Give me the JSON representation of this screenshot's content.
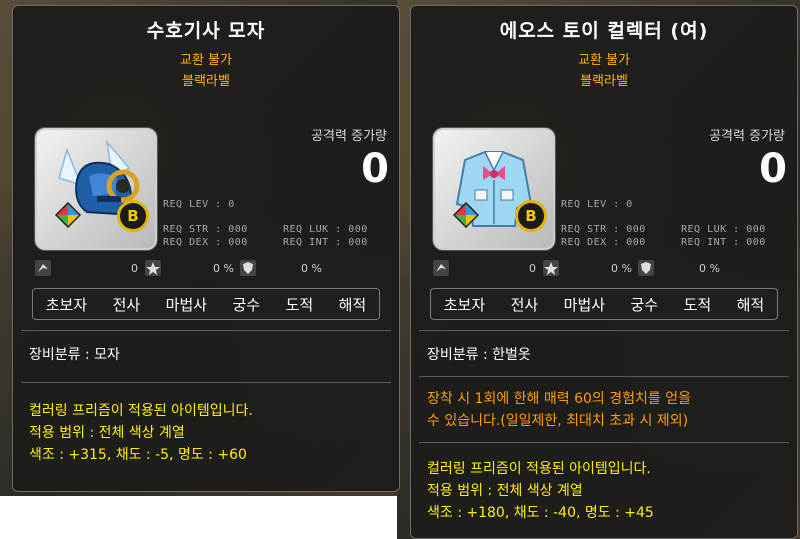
{
  "left_tooltip": {
    "title": "수호기사 모자",
    "tradeable": "교환 불가",
    "label": "블랙라벨",
    "attack_increase_label": "공격력 증가량",
    "attack_increase_value": "0",
    "badge_letter": "B",
    "req": {
      "lev": "REQ LEV :   0",
      "str": "REQ STR : 000",
      "dex": "REQ DEX : 000",
      "luk": "REQ LUK : 000",
      "int": "REQ INT : 000"
    },
    "stats": [
      "0",
      "0 %",
      "0 %"
    ],
    "jobs": [
      "초보자",
      "전사",
      "마법사",
      "궁수",
      "도적",
      "해적"
    ],
    "equip_type": "장비분류 : 모자",
    "prism_lines": [
      "컬러링 프리즘이 적용된 아이템입니다.",
      "적용 범위 : 전체 색상 계열",
      "색조 : +315, 채도 : -5, 명도 : +60"
    ]
  },
  "right_tooltip": {
    "title": "에오스 토이 컬렉터 (여)",
    "tradeable": "교환 불가",
    "label": "블랙라벨",
    "attack_increase_label": "공격력 증가량",
    "attack_increase_value": "0",
    "badge_letter": "B",
    "req": {
      "lev": "REQ LEV :   0",
      "str": "REQ STR : 000",
      "dex": "REQ DEX : 000",
      "luk": "REQ LUK : 000",
      "int": "REQ INT : 000"
    },
    "stats": [
      "0",
      "0 %",
      "0 %"
    ],
    "jobs": [
      "초보자",
      "전사",
      "마법사",
      "궁수",
      "도적",
      "해적"
    ],
    "equip_type": "장비분류 : 한벌옷",
    "effect_lines": [
      "장착 시 1회에 한해 매력 60의 경험치를 얻을",
      "수 있습니다.(일일제한, 최대치 초과 시 제외)"
    ],
    "prism_lines": [
      "컬러링 프리즘이 적용된 아이템입니다.",
      "적용 범위 : 전체 색상 계열",
      "색조 : +180, 채도 : -40, 명도 : +45"
    ]
  },
  "colors": {
    "title": "#ffffff",
    "tradeable": "#ffb400",
    "effect": "#ff9c00",
    "prism": "#ffee00"
  },
  "icons": {
    "item_left": "knight-helmet-icon",
    "item_right": "toy-collector-jacket-icon",
    "gem": "coloring-prism-gem-icon",
    "badge": "black-label-b-badge-icon",
    "stat1": "wing-icon",
    "stat2": "star-upgrade-icon",
    "stat3": "shield-icon"
  }
}
